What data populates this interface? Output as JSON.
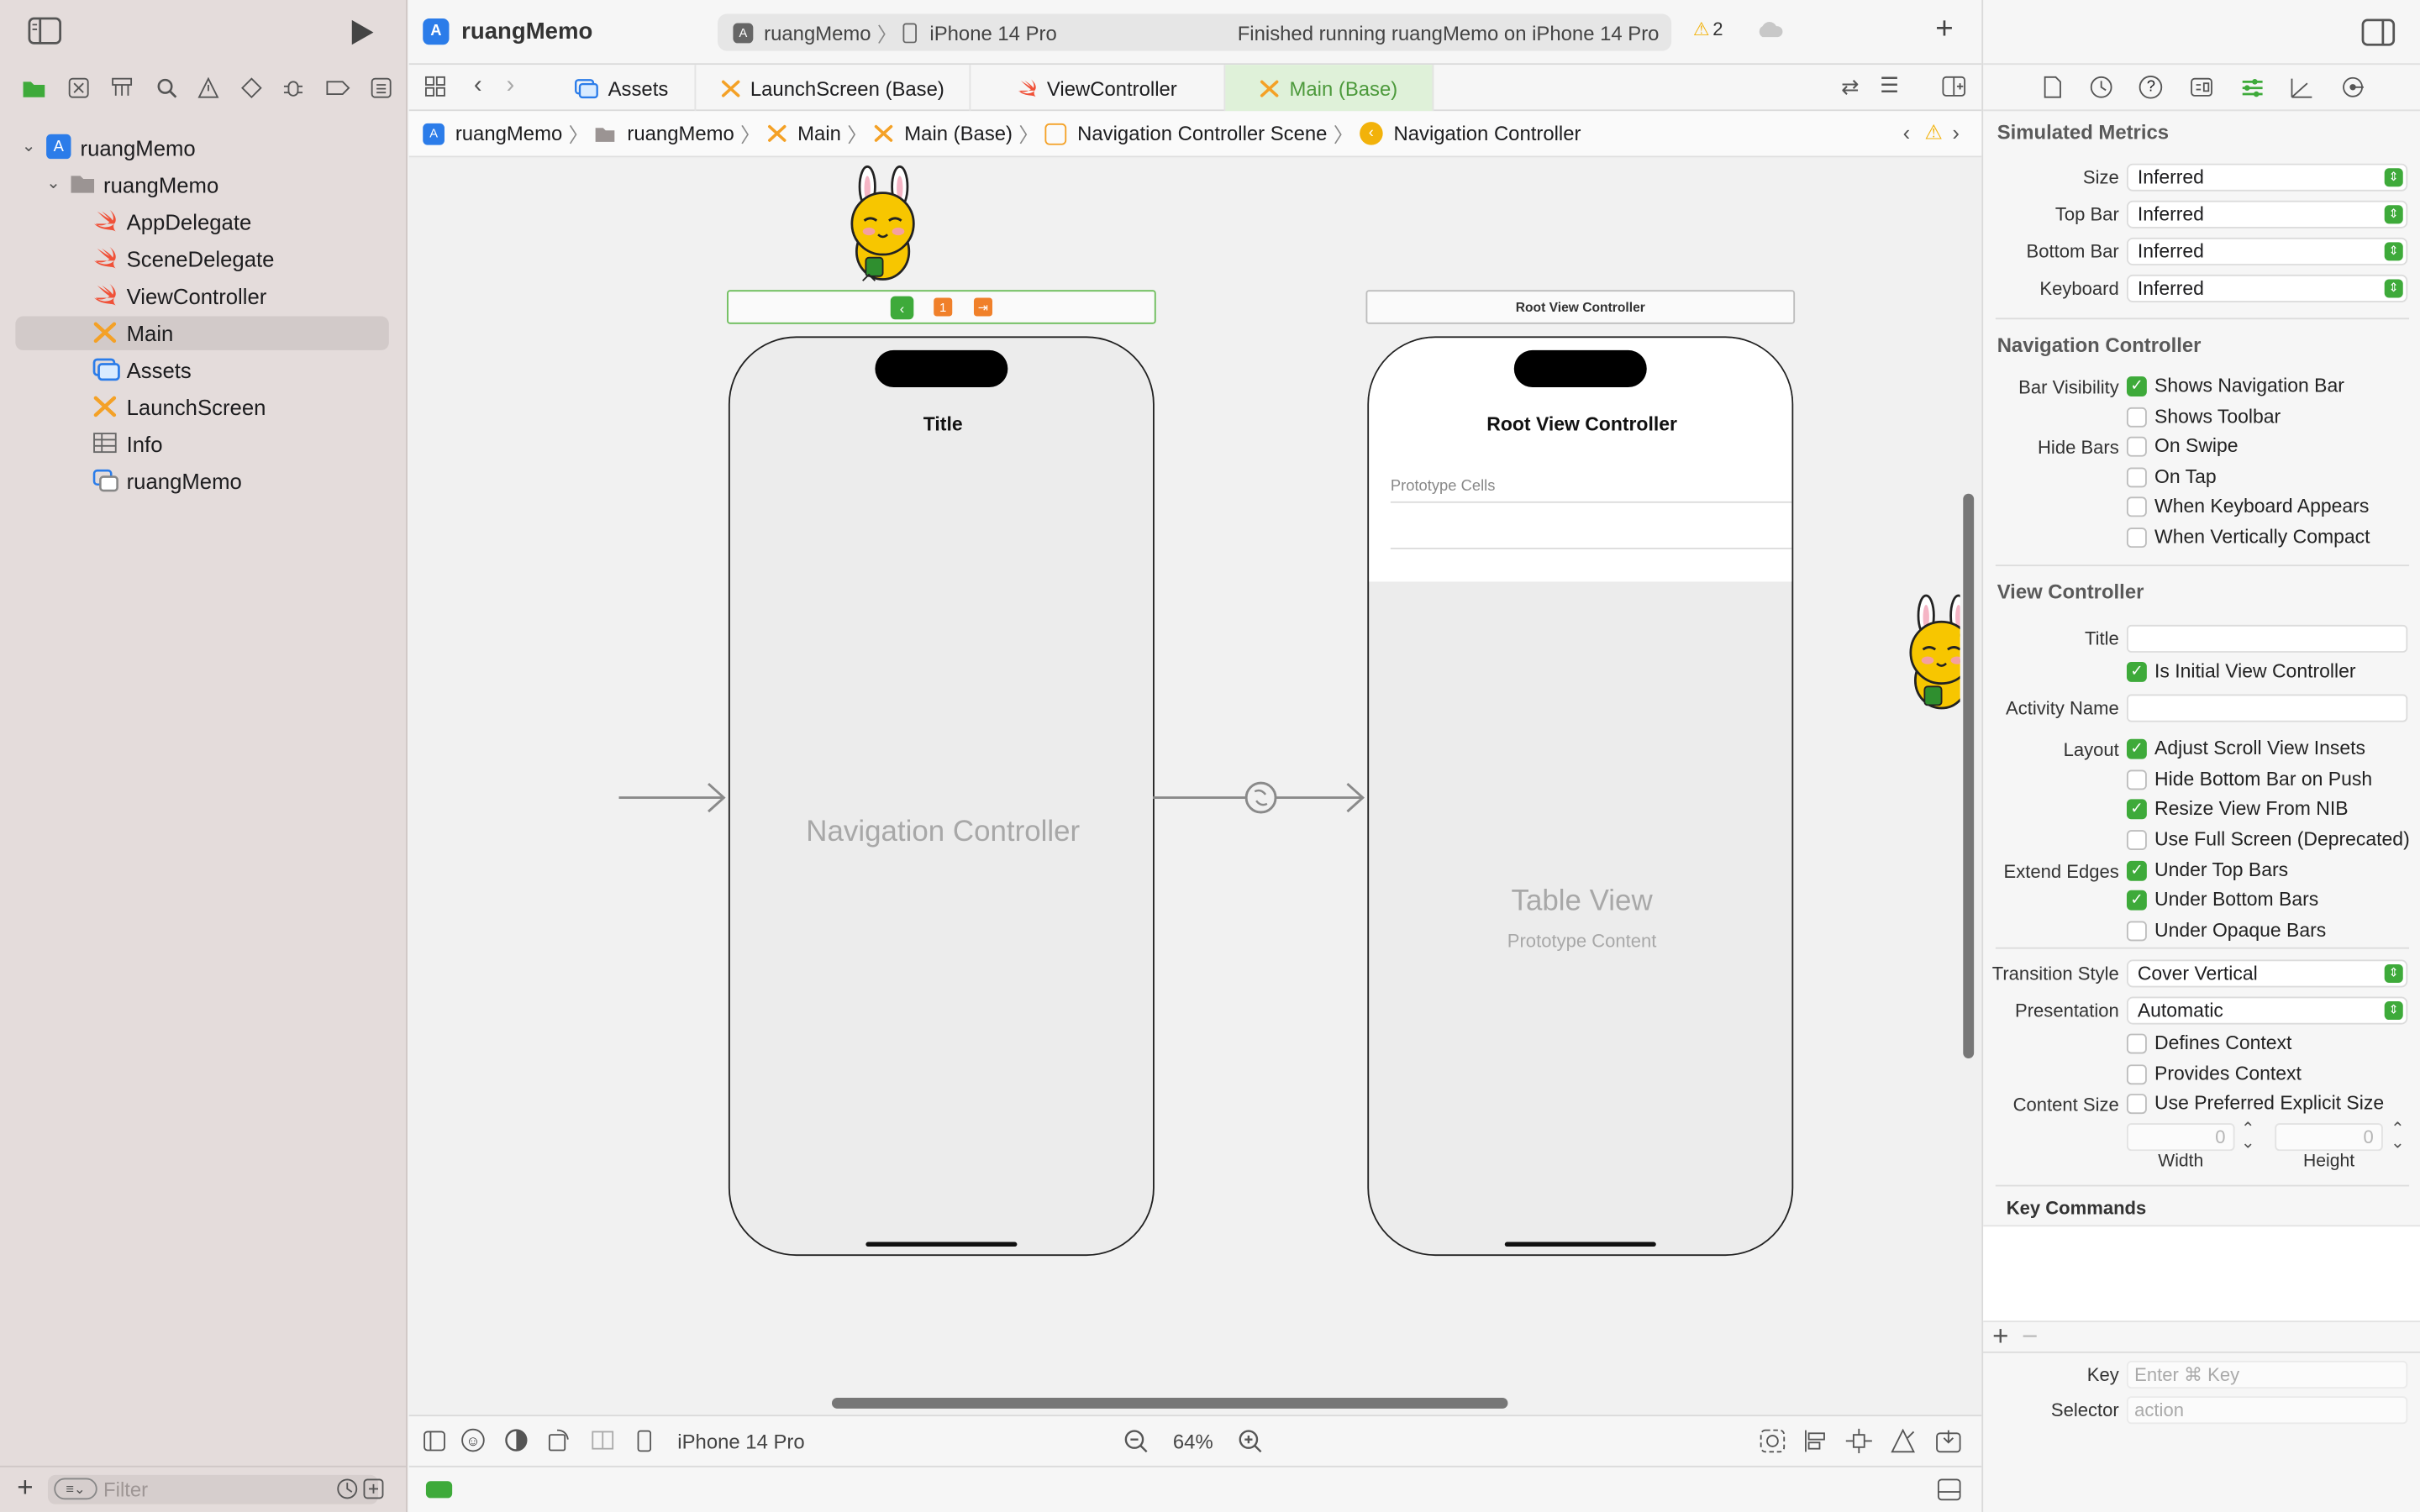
{
  "window": {
    "project_name": "ruangMemo"
  },
  "scheme": {
    "target": "ruangMemo",
    "device": "iPhone 14 Pro",
    "status": "Finished running ruangMemo on iPhone 14 Pro",
    "warning_count": "2"
  },
  "tabs": [
    {
      "label": "Assets",
      "icon": "assets-icon"
    },
    {
      "label": "LaunchScreen (Base)",
      "icon": "storyboard-icon"
    },
    {
      "label": "ViewController",
      "icon": "swift-icon"
    },
    {
      "label": "Main (Base)",
      "icon": "storyboard-icon",
      "active": true
    }
  ],
  "breadcrumbs": [
    "ruangMemo",
    "ruangMemo",
    "Main",
    "Main (Base)",
    "Navigation Controller Scene",
    "Navigation Controller"
  ],
  "navigator": {
    "items": [
      {
        "label": "ruangMemo",
        "icon": "project-icon",
        "level": 0
      },
      {
        "label": "ruangMemo",
        "icon": "folder-icon",
        "level": 1
      },
      {
        "label": "AppDelegate",
        "icon": "swift-icon",
        "level": 2
      },
      {
        "label": "SceneDelegate",
        "icon": "swift-icon",
        "level": 2
      },
      {
        "label": "ViewController",
        "icon": "swift-icon",
        "level": 2
      },
      {
        "label": "Main",
        "icon": "storyboard-icon",
        "level": 2,
        "selected": true
      },
      {
        "label": "Assets",
        "icon": "assets-icon",
        "level": 2
      },
      {
        "label": "LaunchScreen",
        "icon": "storyboard-icon",
        "level": 2
      },
      {
        "label": "Info",
        "icon": "plist-icon",
        "level": 2
      },
      {
        "label": "ruangMemo",
        "icon": "entitlements-icon",
        "level": 2
      }
    ],
    "filter_placeholder": "Filter"
  },
  "canvas": {
    "nav_controller": {
      "nav_title": "Title",
      "center_label": "Navigation Controller"
    },
    "root_vc": {
      "scene_title": "Root View Controller",
      "nav_title": "Root View Controller",
      "section_label": "Prototype Cells",
      "center_label": "Table View",
      "center_sublabel": "Prototype Content"
    }
  },
  "bottom_bar": {
    "device": "iPhone 14 Pro",
    "zoom": "64%"
  },
  "inspector": {
    "simulated_metrics": {
      "title": "Simulated Metrics",
      "rows": [
        {
          "label": "Size",
          "value": "Inferred"
        },
        {
          "label": "Top Bar",
          "value": "Inferred"
        },
        {
          "label": "Bottom Bar",
          "value": "Inferred"
        },
        {
          "label": "Keyboard",
          "value": "Inferred"
        }
      ]
    },
    "navigation_controller": {
      "title": "Navigation Controller",
      "bar_visibility_label": "Bar Visibility",
      "hide_bars_label": "Hide Bars",
      "bar_visibility": [
        {
          "label": "Shows Navigation Bar",
          "checked": true
        },
        {
          "label": "Shows Toolbar",
          "checked": false
        }
      ],
      "hide_bars": [
        {
          "label": "On Swipe",
          "checked": false
        },
        {
          "label": "On Tap",
          "checked": false
        },
        {
          "label": "When Keyboard Appears",
          "checked": false
        },
        {
          "label": "When Vertically Compact",
          "checked": false
        }
      ]
    },
    "view_controller": {
      "title": "View Controller",
      "title_label": "Title",
      "title_value": "",
      "initial_label": "Is Initial View Controller",
      "initial_checked": true,
      "activity_label": "Activity Name",
      "activity_value": "",
      "layout_label": "Layout",
      "layout": [
        {
          "label": "Adjust Scroll View Insets",
          "checked": true
        },
        {
          "label": "Hide Bottom Bar on Push",
          "checked": false
        },
        {
          "label": "Resize View From NIB",
          "checked": true
        },
        {
          "label": "Use Full Screen (Deprecated)",
          "checked": false
        }
      ],
      "extend_edges_label": "Extend Edges",
      "extend_edges": [
        {
          "label": "Under Top Bars",
          "checked": true
        },
        {
          "label": "Under Bottom Bars",
          "checked": true
        },
        {
          "label": "Under Opaque Bars",
          "checked": false
        }
      ],
      "transition_style_label": "Transition Style",
      "transition_style": "Cover Vertical",
      "presentation_label": "Presentation",
      "presentation": "Automatic",
      "context": [
        {
          "label": "Defines Context",
          "checked": false
        },
        {
          "label": "Provides Context",
          "checked": false
        }
      ],
      "content_size_label": "Content Size",
      "content_size_check": "Use Preferred Explicit Size",
      "content_size_checked": false,
      "width_value": "0",
      "height_value": "0",
      "width_label": "Width",
      "height_label": "Height"
    },
    "key_commands": {
      "title": "Key Commands",
      "key_label": "Key",
      "key_placeholder": "Enter ⌘ Key",
      "selector_label": "Selector",
      "selector_placeholder": "action"
    }
  },
  "colors": {
    "accent_green": "#3eaa3a",
    "swift_orange": "#f05138",
    "storyboard_orange": "#f4a126",
    "project_blue": "#2b7ce9",
    "warning_yellow": "#f2b20a"
  }
}
